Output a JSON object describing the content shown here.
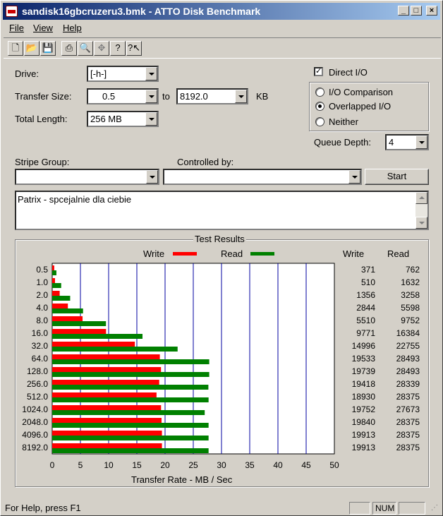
{
  "window": {
    "title": "sandisk16gbcruzeru3.bmk - ATTO Disk Benchmark",
    "controls": [
      "minimize",
      "maximize",
      "close"
    ]
  },
  "menu": [
    "File",
    "View",
    "Help"
  ],
  "toolbar": {
    "icons": [
      "new-icon",
      "open-icon",
      "save-icon",
      "print-icon",
      "print-preview-icon",
      "move-icon",
      "help-icon",
      "context-help-icon"
    ]
  },
  "form": {
    "drive_label": "Drive:",
    "drive_value": "[-h-]",
    "transfer_size_label": "Transfer Size:",
    "transfer_from": "0.5",
    "to_label": "to",
    "transfer_to": "8192.0",
    "kb_label": "KB",
    "total_length_label": "Total Length:",
    "total_length_value": "256 MB",
    "direct_io_label": "Direct I/O",
    "direct_io_checked": true,
    "io_comparison_label": "I/O Comparison",
    "overlapped_io_label": "Overlapped I/O",
    "neither_label": "Neither",
    "selected_mode": "Overlapped I/O",
    "queue_depth_label": "Queue Depth:",
    "queue_depth_value": "4",
    "stripe_group_label": "Stripe Group:",
    "stripe_group_value": "",
    "controlled_by_label": "Controlled by:",
    "controlled_by_value": "",
    "start_button": "Start",
    "description": "Patrix - spcejalnie dla ciebie"
  },
  "results": {
    "title": "Test Results",
    "legend_write": "Write",
    "legend_read": "Read",
    "write_color": "#ff0000",
    "read_color": "#008000",
    "col_write": "Write",
    "col_read": "Read"
  },
  "chart_data": {
    "type": "bar",
    "orientation": "horizontal",
    "xlabel": "Transfer Rate - MB / Sec",
    "xlim": [
      0,
      50
    ],
    "xticks": [
      "0",
      "5",
      "10",
      "15",
      "20",
      "25",
      "30",
      "35",
      "40",
      "45",
      "50"
    ],
    "categories": [
      "0.5",
      "1.0",
      "2.0",
      "4.0",
      "8.0",
      "16.0",
      "32.0",
      "64.0",
      "128.0",
      "256.0",
      "512.0",
      "1024.0",
      "2048.0",
      "4096.0",
      "8192.0"
    ],
    "series": [
      {
        "name": "Write",
        "values": [
          371,
          510,
          1356,
          2844,
          5510,
          9771,
          14996,
          19533,
          19739,
          19418,
          18930,
          19752,
          19840,
          19913,
          19913
        ]
      },
      {
        "name": "Read",
        "values": [
          762,
          1632,
          3258,
          5598,
          9752,
          16384,
          22755,
          28493,
          28493,
          28339,
          28375,
          27673,
          28375,
          28375,
          28375
        ]
      }
    ],
    "write_display": [
      "371",
      "510",
      "1356",
      "2844",
      "5510",
      "9771",
      "14996",
      "19533",
      "19739",
      "19418",
      "18930",
      "19752",
      "19840",
      "19913",
      "19913"
    ],
    "read_display": [
      "762",
      "1632",
      "3258",
      "5598",
      "9752",
      "16384",
      "22755",
      "28493",
      "28493",
      "28339",
      "28375",
      "27673",
      "28375",
      "28375",
      "28375"
    ],
    "grid": true
  },
  "status": {
    "help_text": "For Help, press F1",
    "num_indicator": "NUM"
  }
}
